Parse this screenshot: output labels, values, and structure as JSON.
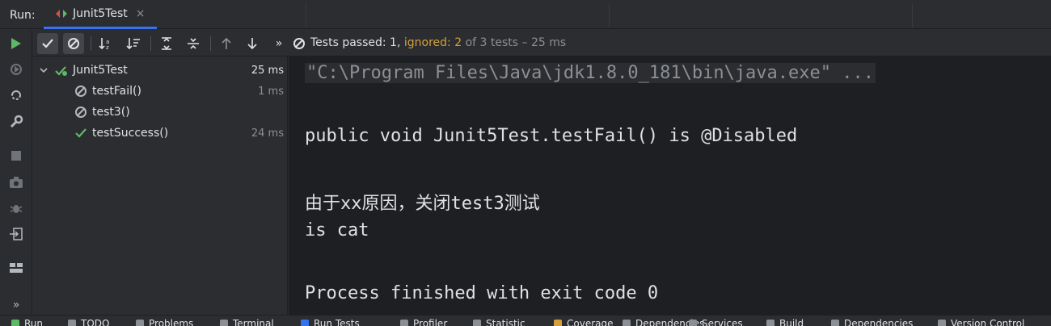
{
  "header": {
    "run_label": "Run:",
    "tab_title": "Junit5Test",
    "tab_close": "×"
  },
  "toolbar": {
    "more_glyph": "»",
    "status_passed": "Tests passed: 1,",
    "status_ignored": "ignored: 2",
    "status_rest": "of 3 tests – 25 ms"
  },
  "tree": {
    "root": {
      "label": "Junit5Test",
      "time": "25 ms"
    },
    "items": [
      {
        "label": "testFail()",
        "time": "1 ms",
        "status": "ignored"
      },
      {
        "label": "test3()",
        "time": "",
        "status": "ignored"
      },
      {
        "label": "testSuccess()",
        "time": "24 ms",
        "status": "passed"
      }
    ]
  },
  "console": {
    "lines": [
      "\"C:\\Program Files\\Java\\jdk1.8.0_181\\bin\\java.exe\" ...",
      "public void Junit5Test.testFail() is @Disabled",
      "由于xx原因，关闭test3测试",
      "is cat",
      "Process finished with exit code 0"
    ]
  },
  "leftbar": {
    "more_glyph": "»"
  },
  "bottombar": {
    "items": [
      "Run",
      "TODO",
      "Problems",
      "Terminal",
      "Run Tests",
      "Profiler",
      "Statistic",
      "Coverage",
      "Dependencies",
      "Services",
      "Build",
      "Dependencies",
      "Version Control"
    ]
  },
  "colors": {
    "accent": "#3574f0",
    "passed": "#5fb865",
    "ignored": "#d4a03c",
    "run": "#5fb865"
  }
}
